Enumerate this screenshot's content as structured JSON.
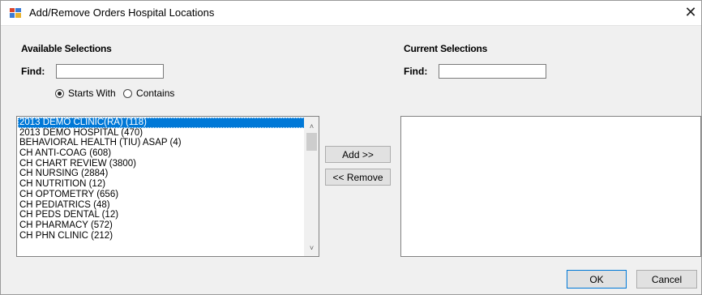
{
  "window": {
    "title": "Add/Remove Orders Hospital Locations"
  },
  "available": {
    "heading": "Available Selections",
    "find_label": "Find:",
    "find_value": "",
    "options": {
      "starts_with": "Starts With",
      "contains": "Contains",
      "selected": "starts_with"
    },
    "items": [
      "2013 DEMO CLINIC(RA) (118)",
      "2013 DEMO HOSPITAL (470)",
      "BEHAVIORAL HEALTH (TIU) ASAP (4)",
      "CH ANTI-COAG (608)",
      "CH CHART REVIEW (3800)",
      "CH NURSING (2884)",
      "CH NUTRITION (12)",
      "CH OPTOMETRY (656)",
      "CH PEDIATRICS (48)",
      "CH PEDS DENTAL (12)",
      "CH PHARMACY (572)",
      "CH PHN CLINIC (212)"
    ],
    "selected_index": 0
  },
  "current": {
    "heading": "Current Selections",
    "find_label": "Find:",
    "find_value": "",
    "items": []
  },
  "buttons": {
    "add": "Add >>",
    "remove": "<< Remove",
    "ok": "OK",
    "cancel": "Cancel"
  },
  "icons": {
    "close": "close-icon",
    "app": "app-icon",
    "scroll_up": "scroll-up-icon",
    "scroll_down": "scroll-down-icon"
  },
  "colors": {
    "selection": "#0078d7",
    "window_bg": "#f0f0f0"
  }
}
